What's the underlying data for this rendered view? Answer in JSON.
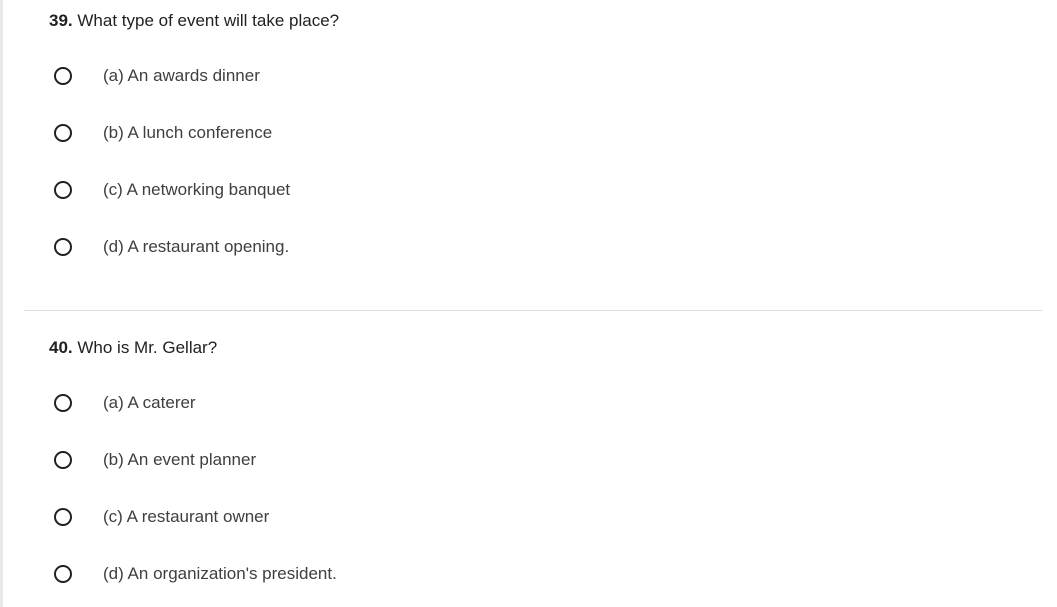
{
  "questions": [
    {
      "number": "39.",
      "text": " What type of event will take place?",
      "options": [
        "(a) An awards dinner",
        "(b) A lunch conference",
        "(c) A networking banquet",
        "(d) A restaurant opening."
      ]
    },
    {
      "number": "40.",
      "text": " Who is Mr. Gellar?",
      "options": [
        "(a) A caterer",
        "(b) An event planner",
        "(c) A restaurant owner",
        "(d) An organization's president."
      ]
    }
  ]
}
